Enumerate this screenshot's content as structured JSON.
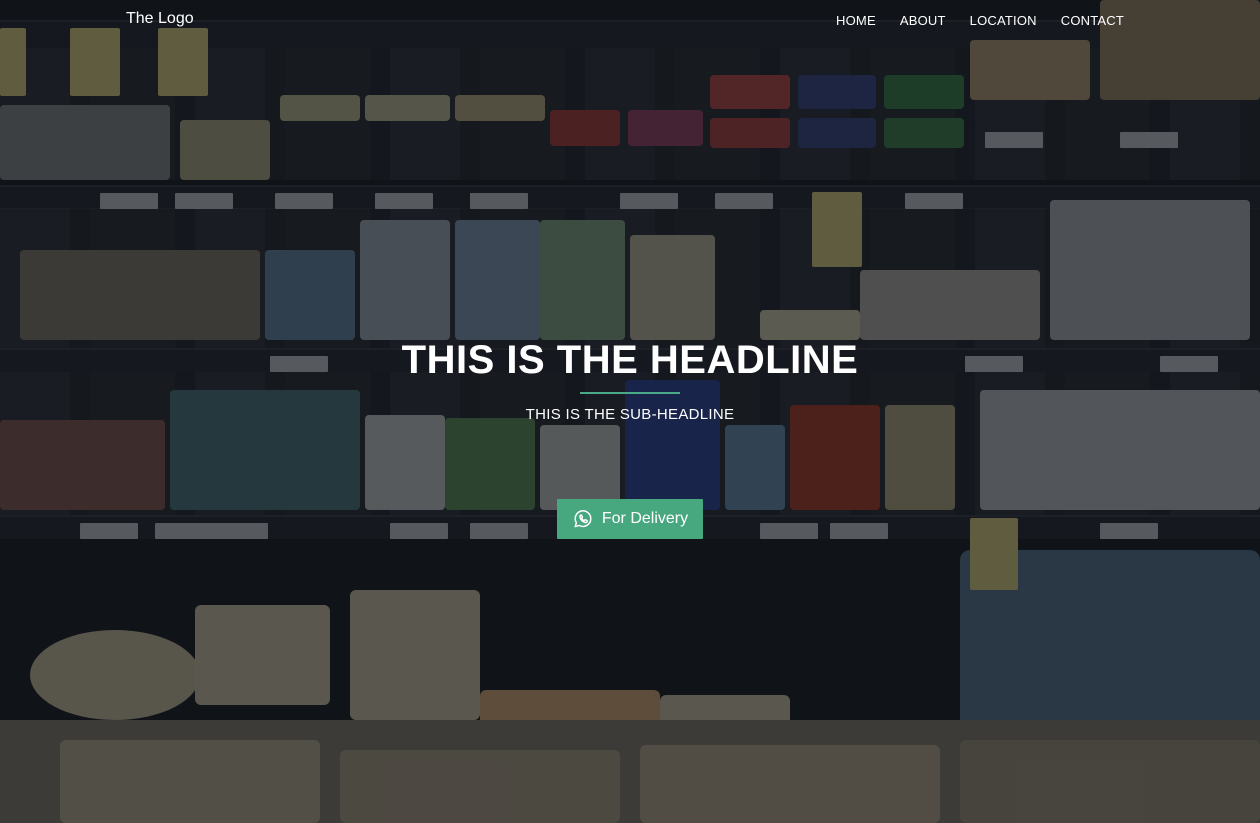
{
  "header": {
    "logo_text": "The Logo",
    "nav": [
      {
        "label": "HOME"
      },
      {
        "label": "ABOUT"
      },
      {
        "label": "LOCATION"
      },
      {
        "label": "CONTACT"
      }
    ]
  },
  "hero": {
    "headline": "THIS IS THE HEADLINE",
    "subheadline": "THIS IS THE SUB-HEADLINE",
    "cta_label": "For Delivery",
    "cta_icon": "whatsapp-icon",
    "accent_color": "#47a880"
  },
  "background": {
    "description_icon": "grocery-shelf-background-image"
  }
}
